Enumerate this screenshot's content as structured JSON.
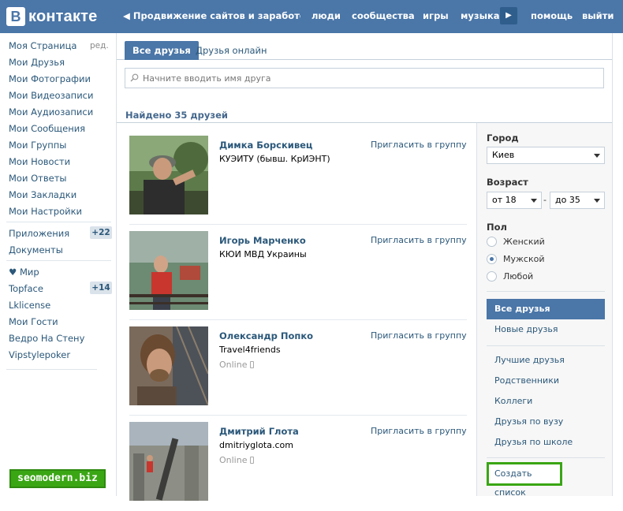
{
  "header": {
    "logo_letter": "B",
    "logo_text": "контакте",
    "promo": "Продвижение сайтов и заработок в интернете",
    "nav": [
      "люди",
      "сообщества",
      "игры",
      "музыка",
      "помощь",
      "выйти"
    ]
  },
  "sidebar": {
    "edit_label": "ред.",
    "items": [
      "Моя Страница",
      "Мои Друзья",
      "Мои Фотографии",
      "Мои Видеозаписи",
      "Мои Аудиозаписи",
      "Мои Сообщения",
      "Мои Группы",
      "Мои Новости",
      "Мои Ответы",
      "Мои Закладки",
      "Мои Настройки"
    ],
    "apps": [
      {
        "label": "Приложения",
        "badge": "+22"
      },
      {
        "label": "Документы",
        "badge": ""
      }
    ],
    "extra": [
      {
        "label": "♥ Мир",
        "badge": ""
      },
      {
        "label": "Topface",
        "badge": "+14"
      },
      {
        "label": "Lklicense",
        "badge": ""
      },
      {
        "label": "Мои Гости",
        "badge": ""
      },
      {
        "label": "Ведро На Стену",
        "badge": ""
      },
      {
        "label": "Vipstylepoker",
        "badge": ""
      }
    ],
    "watermark": "seomodern.biz"
  },
  "tabs": [
    "Все друзья",
    "Друзья онлайн"
  ],
  "search": {
    "placeholder": "Начните вводить имя друга"
  },
  "found_label": "Найдено 35 друзей",
  "invite_label": "Пригласить в группу",
  "friends": [
    {
      "name": "Димка Борскивец",
      "sub": "КУЭИТУ (бывш. КрИЭНТ)",
      "online": ""
    },
    {
      "name": "Игорь Марченко",
      "sub": "КЮИ МВД Украины",
      "online": ""
    },
    {
      "name": "Олександр Попко",
      "sub": "Travel4friends",
      "online": "Online"
    },
    {
      "name": "Дмитрий Глота",
      "sub": "dmitriyglota.com",
      "online": "Online"
    }
  ],
  "filters": {
    "city_label": "Город",
    "city_value": "Киев",
    "age_label": "Возраст",
    "age_from": "от 18",
    "age_to": "до 35",
    "age_dash": "-",
    "gender_label": "Пол",
    "gender_options": [
      "Женский",
      "Мужской",
      "Любой"
    ],
    "gender_selected": "Мужской",
    "lists_top": [
      "Все друзья",
      "Новые друзья"
    ],
    "lists": [
      "Лучшие друзья",
      "Родственники",
      "Коллеги",
      "Друзья по вузу",
      "Друзья по школе"
    ],
    "create_list": "Создать список"
  }
}
